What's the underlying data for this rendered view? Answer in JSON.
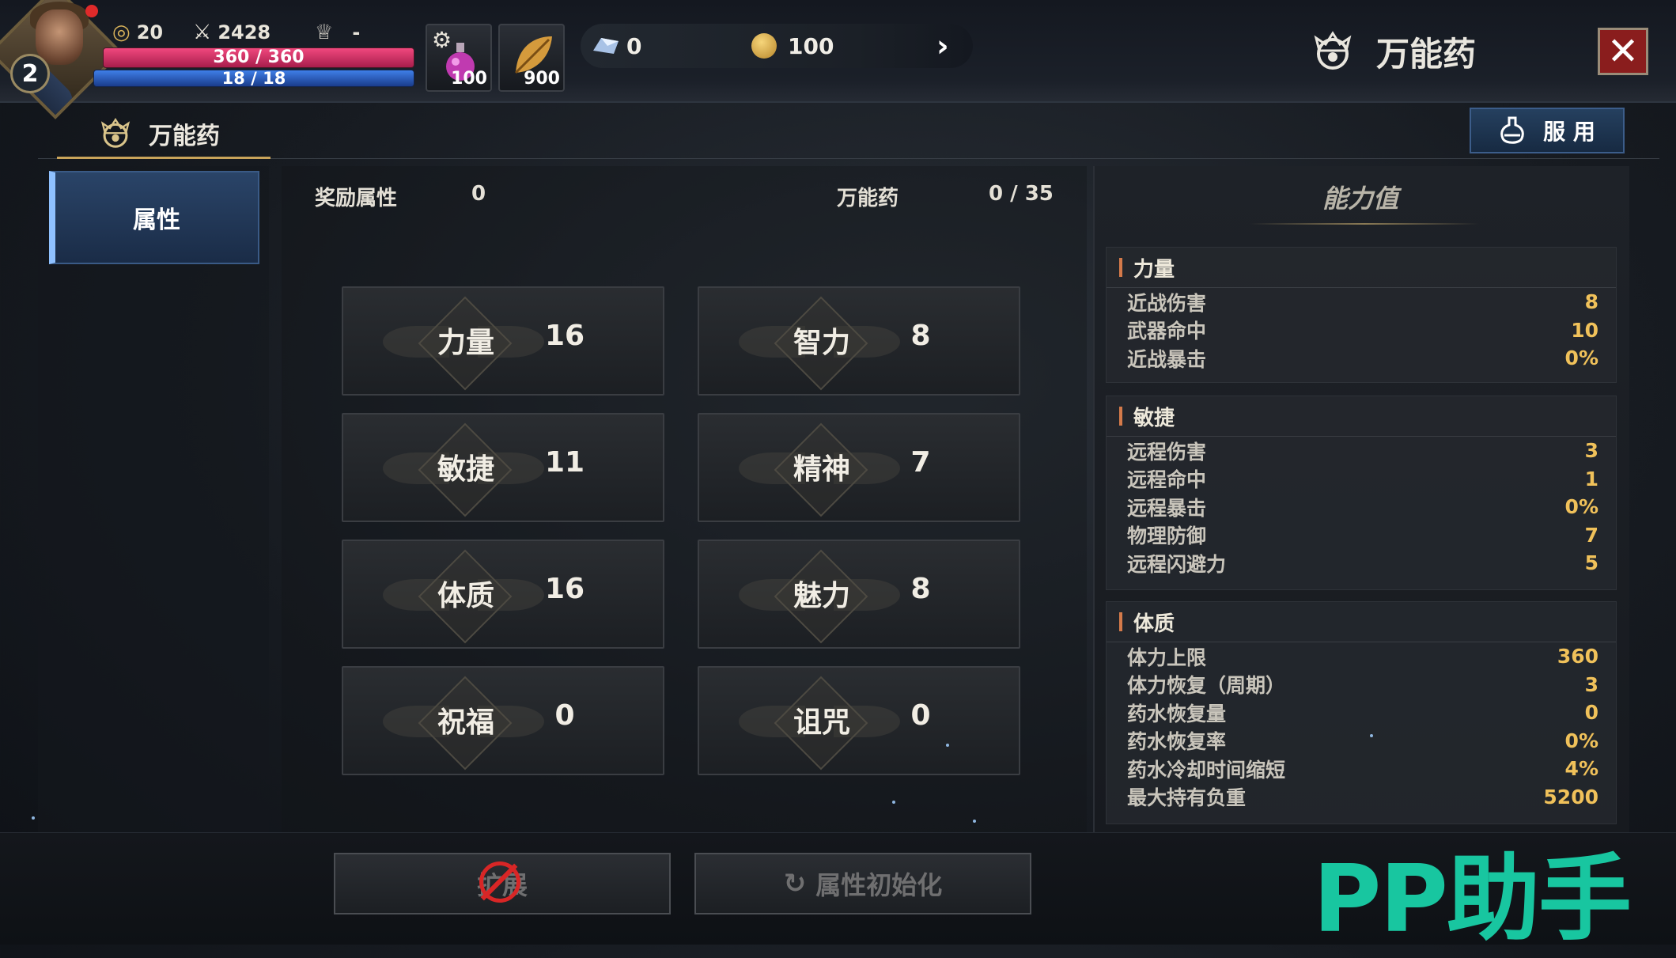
{
  "player": {
    "level": "2",
    "stamina": "20",
    "combat_power": "2428",
    "rank": "-",
    "hp": "360 / 360",
    "mp": "18 / 18"
  },
  "quick_items": [
    {
      "icon": "potion-icon",
      "count": "100"
    },
    {
      "icon": "leaf-icon",
      "count": "900"
    }
  ],
  "currency": {
    "gem": "0",
    "gold": "100"
  },
  "window": {
    "title": "万能药",
    "close": "✕"
  },
  "subtab": {
    "label": "万能药"
  },
  "use_button": {
    "label": "服 用"
  },
  "left_tabs": [
    {
      "label": "属性"
    }
  ],
  "summary": {
    "bonus_label": "奖励属性",
    "bonus_value": "0",
    "panacea_label": "万能药",
    "panacea_value": "0 / 35"
  },
  "stats": [
    {
      "name": "力量",
      "value": "16"
    },
    {
      "name": "智力",
      "value": "8"
    },
    {
      "name": "敏捷",
      "value": "11"
    },
    {
      "name": "精神",
      "value": "7"
    },
    {
      "name": "体质",
      "value": "16"
    },
    {
      "name": "魅力",
      "value": "8"
    },
    {
      "name": "祝福",
      "value": "0"
    },
    {
      "name": "诅咒",
      "value": "0"
    }
  ],
  "ability": {
    "title": "能力值",
    "groups": [
      {
        "name": "力量",
        "rows": [
          {
            "label": "近战伤害",
            "value": "8"
          },
          {
            "label": "武器命中",
            "value": "10"
          },
          {
            "label": "近战暴击",
            "value": "0%"
          }
        ]
      },
      {
        "name": "敏捷",
        "rows": [
          {
            "label": "远程伤害",
            "value": "3"
          },
          {
            "label": "远程命中",
            "value": "1"
          },
          {
            "label": "远程暴击",
            "value": "0%"
          },
          {
            "label": "物理防御",
            "value": "7"
          },
          {
            "label": "远程闪避力",
            "value": "5"
          }
        ]
      },
      {
        "name": "体质",
        "rows": [
          {
            "label": "体力上限",
            "value": "360"
          },
          {
            "label": "体力恢复（周期）",
            "value": "3"
          },
          {
            "label": "药水恢复量",
            "value": "0"
          },
          {
            "label": "药水恢复率",
            "value": "0%"
          },
          {
            "label": "药水冷却时间缩短",
            "value": "4%"
          },
          {
            "label": "最大持有负重",
            "value": "5200"
          }
        ]
      }
    ]
  },
  "bottom": {
    "expand": "扩展",
    "reset": "属性初始化"
  },
  "watermark": "PP助手",
  "colors": {
    "accent": "#c9a45a",
    "hp": "#e0366c",
    "mp": "#2f6ad8",
    "value": "#f0c15a",
    "watermark": "#18c6a0"
  }
}
